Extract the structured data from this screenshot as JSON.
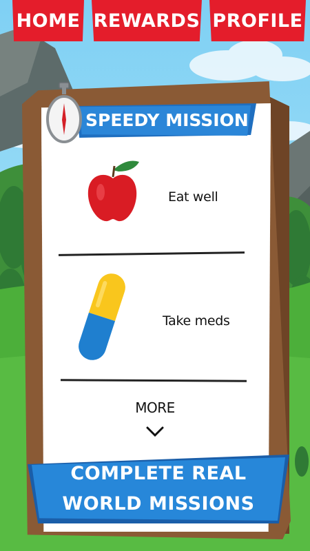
{
  "nav": {
    "home_label": "HOME",
    "rewards_label": "REWARDS",
    "profile_label": "PROFILE"
  },
  "mission_card": {
    "title": "SPEEDY MISSION",
    "items": [
      {
        "label": "Eat well",
        "icon": "apple-icon"
      },
      {
        "label": "Take meds",
        "icon": "pill-icon"
      }
    ],
    "more_label": "MORE"
  },
  "banner": {
    "line1": "COMPLETE REAL",
    "line2": "WORLD MISSIONS"
  },
  "colors": {
    "tab_red": "#e41d2b",
    "banner_blue": "#2787d9",
    "board_brown": "#8a5a35",
    "sky_blue": "#8fd6f5",
    "grass_green": "#4caf3a"
  }
}
